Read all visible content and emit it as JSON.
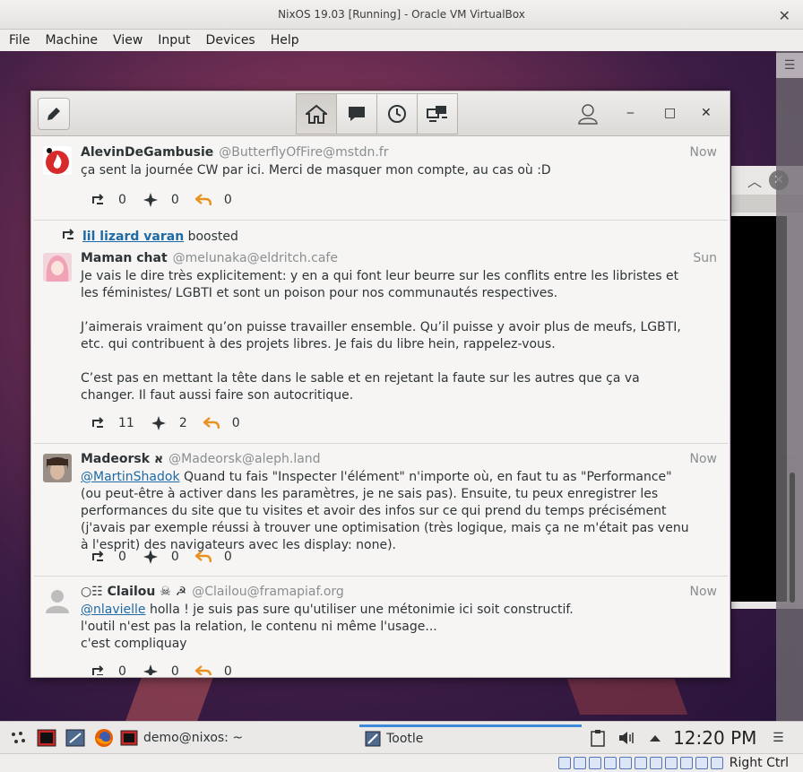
{
  "host": {
    "title": "NixOS 19.03 [Running] - Oracle VM VirtualBox",
    "menu": [
      "File",
      "Machine",
      "View",
      "Input",
      "Devices",
      "Help"
    ],
    "host_key": "Right Ctrl"
  },
  "tootle": {
    "tabs": [
      "home-icon",
      "notifications-icon",
      "local-timeline-icon",
      "federated-timeline-icon"
    ],
    "active_tab": 0,
    "posts": [
      {
        "name": "AlevinDeGambusie",
        "handle": "@ButterflyOfFire@mstdn.fr",
        "time": "Now",
        "body": [
          "ça sent la journée CW par ici. Merci de masquer mon compte, au cas où :D"
        ],
        "reblogs": "0",
        "favourites": "0",
        "replies": "0"
      },
      {
        "boosted_by": "lil lizard varan",
        "boosted_label": "boosted",
        "name": "Maman chat",
        "handle": "@melunaka@eldritch.cafe",
        "time": "Sun",
        "body": [
          "Je vais le dire très explicitement: y en a qui font leur beurre sur les conflits entre les libristes et les féministes/ LGBTI et sont un poison pour nos communautés respectives.",
          "J’aimerais vraiment qu’on puisse travailler ensemble. Qu’il puisse y avoir plus de meufs, LGBTI, etc. qui contribuent à des projets libres. Je fais du libre hein, rappelez-vous.",
          "C’est pas en mettant la tête dans le sable et en rejetant la faute sur les autres que ça va changer. Il faut aussi faire son autocritique."
        ],
        "reblogs": "11",
        "favourites": "2",
        "replies": "0"
      },
      {
        "name": "Madeorsk א",
        "handle": "@Madeorsk@aleph.land",
        "time": "Now",
        "mention": "@MartinShadok",
        "body": [
          " Quand tu fais \"Inspecter l'élément\" n'importe où, en faut tu as \"Performance\" (ou peut-être à activer dans les paramètres, je ne sais pas). Ensuite, tu peux enregistrer les performances du site que tu visites et avoir des infos sur ce qui prend du temps précisément (j'avais par exemple réussi à trouver une optimisation (très logique, mais ça ne m'était pas venu à l'esprit) des navigateurs avec les display: none)."
        ],
        "reblogs": "0",
        "favourites": "0",
        "replies": "0"
      },
      {
        "name": "○☷ Clailou ☠ ☭",
        "handle": "@Clailou@framapiaf.org",
        "time": "Now",
        "mention": "@nlavielle",
        "body": [
          " holla ! je suis pas sure qu'utiliser une métonimie ici soit constructif.",
          "l'outil n'est pas la relation, le contenu ni même l'usage...",
          "c'est compliquay"
        ],
        "reblogs": "0",
        "favourites": "0",
        "replies": "0"
      }
    ]
  },
  "taskbar": {
    "tasks": [
      "demo@nixos: ~",
      "Tootle"
    ],
    "clock": "12:20 PM"
  },
  "colors": {
    "link": "#1d6aa5",
    "reply_orange": "#e8911e",
    "taskbar_active": "#3c8ad9"
  }
}
